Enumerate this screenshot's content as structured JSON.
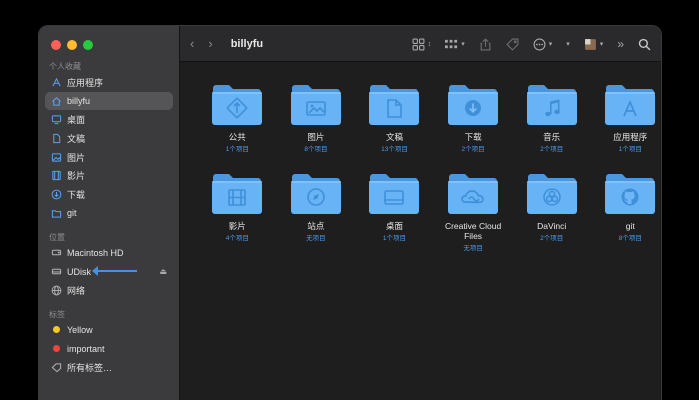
{
  "toolbar": {
    "title": "billyfu"
  },
  "sidebar": {
    "favorites_header": "个人收藏",
    "favorites": [
      {
        "label": "应用程序",
        "icon": "applications-icon"
      },
      {
        "label": "billyfu",
        "icon": "home-icon",
        "active": true
      },
      {
        "label": "桌面",
        "icon": "desktop-icon"
      },
      {
        "label": "文稿",
        "icon": "document-icon"
      },
      {
        "label": "图片",
        "icon": "pictures-icon"
      },
      {
        "label": "影片",
        "icon": "movies-icon"
      },
      {
        "label": "下载",
        "icon": "downloads-icon"
      },
      {
        "label": "git",
        "icon": "folder-icon"
      }
    ],
    "locations_header": "位置",
    "locations": [
      {
        "label": "Macintosh HD",
        "icon": "disk-icon"
      },
      {
        "label": "UDisk",
        "icon": "external-disk-icon"
      },
      {
        "label": "网络",
        "icon": "network-icon"
      }
    ],
    "tags_header": "标签",
    "tags": [
      {
        "label": "Yellow",
        "color": "#f5c823"
      },
      {
        "label": "important",
        "color": "#f0453a"
      },
      {
        "label": "所有标签…",
        "icon": "tag-icon"
      }
    ]
  },
  "folders": [
    {
      "name": "公共",
      "count": "1个项目",
      "glyph": "public"
    },
    {
      "name": "图片",
      "count": "8个项目",
      "glyph": "pictures"
    },
    {
      "name": "文稿",
      "count": "13个项目",
      "glyph": "document"
    },
    {
      "name": "下载",
      "count": "2个项目",
      "glyph": "download"
    },
    {
      "name": "音乐",
      "count": "2个项目",
      "glyph": "music"
    },
    {
      "name": "应用程序",
      "count": "1个项目",
      "glyph": "apps"
    },
    {
      "name": "影片",
      "count": "4个项目",
      "glyph": "movies"
    },
    {
      "name": "站点",
      "count": "无项目",
      "glyph": "sites"
    },
    {
      "name": "桌面",
      "count": "1个项目",
      "glyph": "desktop"
    },
    {
      "name": "Creative Cloud Files",
      "count": "无项目",
      "glyph": "creative-cloud"
    },
    {
      "name": "DaVinci",
      "count": "2个项目",
      "glyph": "davinci"
    },
    {
      "name": "git",
      "count": "8个项目",
      "glyph": "github"
    }
  ],
  "colors": {
    "folder": "#68b3f6",
    "folder_dark": "#4b97df",
    "accent": "#4e9bec"
  }
}
